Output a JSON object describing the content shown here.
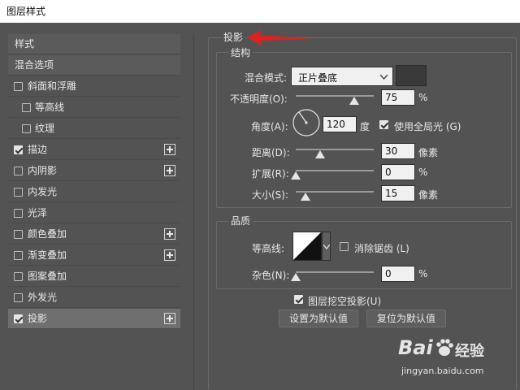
{
  "window": {
    "title": "图层样式"
  },
  "style_list": [
    {
      "label": "样式",
      "type": "header"
    },
    {
      "label": "混合选项",
      "type": "header"
    },
    {
      "label": "斜面和浮雕",
      "checked": false,
      "indent": false,
      "plus": false
    },
    {
      "label": "等高线",
      "checked": false,
      "indent": true,
      "plus": false
    },
    {
      "label": "纹理",
      "checked": false,
      "indent": true,
      "plus": false
    },
    {
      "label": "描边",
      "checked": true,
      "indent": false,
      "plus": true
    },
    {
      "label": "内阴影",
      "checked": false,
      "indent": false,
      "plus": true
    },
    {
      "label": "内发光",
      "checked": false,
      "indent": false,
      "plus": false
    },
    {
      "label": "光泽",
      "checked": false,
      "indent": false,
      "plus": false
    },
    {
      "label": "颜色叠加",
      "checked": false,
      "indent": false,
      "plus": true
    },
    {
      "label": "渐变叠加",
      "checked": false,
      "indent": false,
      "plus": true
    },
    {
      "label": "图案叠加",
      "checked": false,
      "indent": false,
      "plus": false
    },
    {
      "label": "外发光",
      "checked": false,
      "indent": false,
      "plus": false
    },
    {
      "label": "投影",
      "checked": true,
      "indent": false,
      "plus": true,
      "selected": true
    }
  ],
  "panel": {
    "title": "投影",
    "structure": {
      "title": "结构",
      "blend_mode_label": "混合模式:",
      "blend_mode_value": "正片叠底",
      "blend_color": "#3a3a3a",
      "opacity_label": "不透明度(O):",
      "opacity_value": "75",
      "opacity_unit": "%",
      "opacity_level": 75,
      "angle_label": "角度(A):",
      "angle_value": "120",
      "angle_unit": "度",
      "global_light_label": "使用全局光 (G)",
      "global_light_checked": true,
      "distance_label": "距离(D):",
      "distance_value": "30",
      "distance_unit": "像素",
      "spread_label": "扩展(R):",
      "spread_value": "0",
      "spread_unit": "%",
      "size_label": "大小(S):",
      "size_value": "15",
      "size_unit": "像素"
    },
    "quality": {
      "title": "品质",
      "contour_label": "等高线:",
      "antialias_label": "消除锯齿 (L)",
      "antialias_checked": false,
      "noise_label": "杂色(N):",
      "noise_value": "0",
      "noise_unit": "%"
    },
    "knockout_label": "图层挖空投影(U)",
    "knockout_checked": true,
    "make_default_label": "设置为默认值",
    "reset_default_label": "复位为默认值"
  },
  "watermark": {
    "brand": "Bai",
    "brand2": "经验",
    "url": "jingyan.baidu.com"
  },
  "colors": {
    "panel_bg": "#535353",
    "annotation_arrow": "#e02020"
  }
}
